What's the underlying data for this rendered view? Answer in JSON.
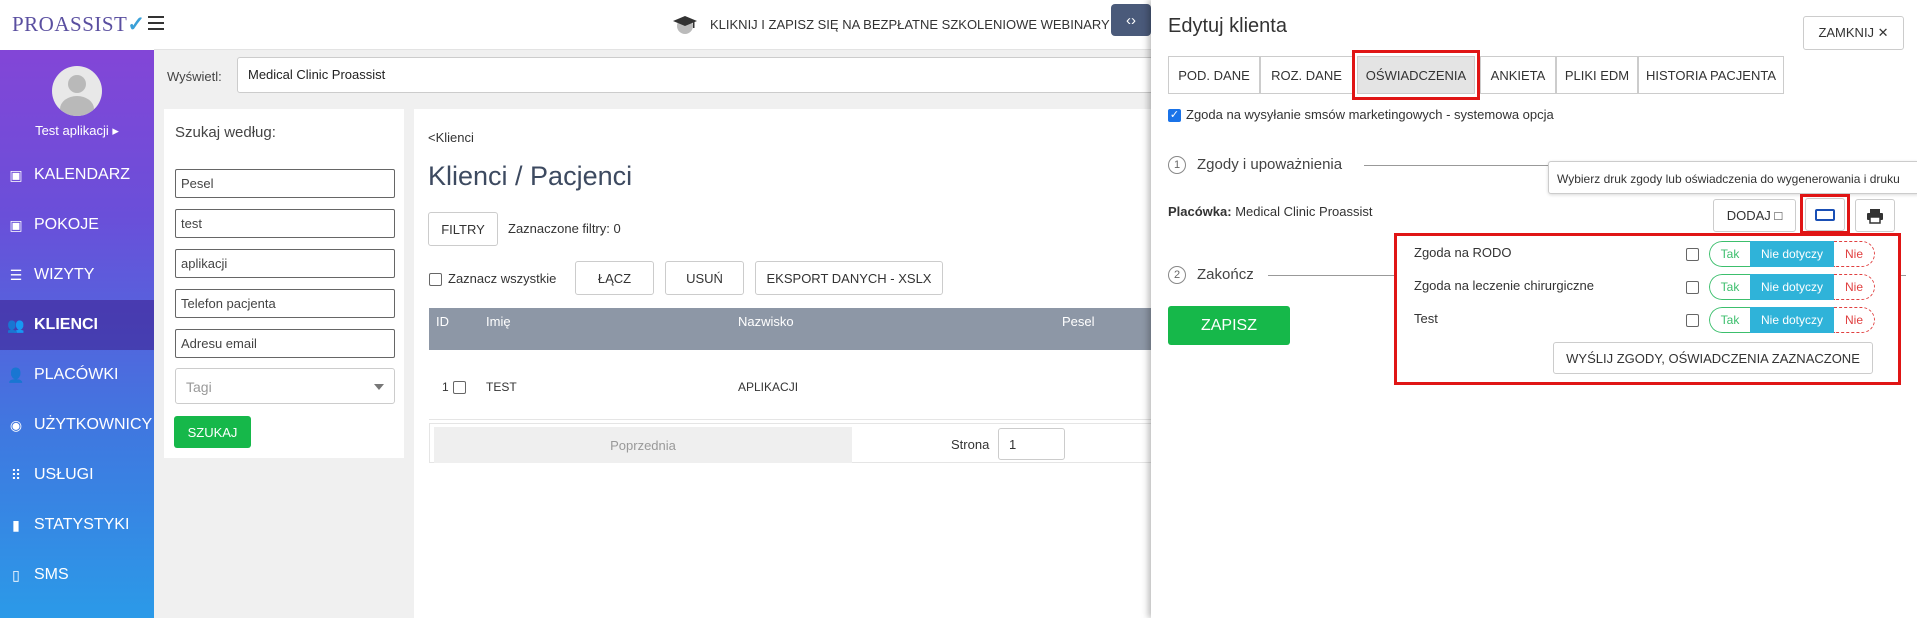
{
  "logo": {
    "text": "PROASSIST",
    "check": "✓"
  },
  "sidebar": {
    "user_name": "Test aplikacji ▸",
    "items": [
      {
        "label": "KALENDARZ",
        "icon": "calendar-icon"
      },
      {
        "label": "POKOJE",
        "icon": "rooms-icon"
      },
      {
        "label": "WIZYTY",
        "icon": "visits-icon"
      },
      {
        "label": "KLIENCI",
        "icon": "clients-icon",
        "active": true
      },
      {
        "label": "PLACÓWKI",
        "icon": "add-user-icon"
      },
      {
        "label": "UŻYTKOWNICY",
        "icon": "user-icon"
      },
      {
        "label": "USŁUGI",
        "icon": "grid-icon"
      },
      {
        "label": "STATYSTYKI",
        "icon": "bar-chart-icon"
      },
      {
        "label": "SMS",
        "icon": "phone-icon"
      }
    ]
  },
  "topbar": {
    "webinar_text": "KLIKNIJ I ZAPISZ SIĘ NA BEZPŁATNE SZKOLENIOWE WEBINARY",
    "toggle": "‹›"
  },
  "display": {
    "label": "Wyświetl:",
    "value": "Medical Clinic Proassist"
  },
  "search": {
    "title": "Szukaj według:",
    "fields": [
      "Pesel",
      "test",
      "aplikacji",
      "Telefon pacjenta",
      "Adresu email"
    ],
    "tags_placeholder": "Tagi",
    "button": "SZUKAJ"
  },
  "clients": {
    "breadcrumb": "<Klienci",
    "title": "Klienci / Pacjenci",
    "filters_button": "FILTRY",
    "filters_info": "Zaznaczone filtry: 0",
    "select_all": "Zaznacz wszystkie",
    "merge_button": "ŁĄCZ",
    "delete_button": "USUŃ",
    "export_button": "EKSPORT DANYCH - XSLX",
    "columns": [
      "ID",
      "Imię",
      "Nazwisko",
      "Pesel"
    ],
    "rows": [
      {
        "id": "1",
        "first": "TEST",
        "last": "APLIKACJI"
      }
    ],
    "prev": "Poprzednia",
    "page_label": "Strona",
    "page": "1"
  },
  "edit": {
    "title": "Edytuj klienta",
    "close": "ZAMKNIJ ✕",
    "tabs": [
      "POD. DANE",
      "ROZ. DANE",
      "OŚWIADCZENIA",
      "ANKIETA",
      "PLIKI EDM",
      "HISTORIA PACJENTA"
    ],
    "consent_label": "Zgoda na wysyłanie smsów marketingowych - systemowa opcja",
    "step1": {
      "num": "1",
      "label": "Zgody i upoważnienia"
    },
    "step2": {
      "num": "2",
      "label": "Zakończ"
    },
    "tooltip": "Wybierz druk zgody lub oświadczenia do wygenerowania i druku",
    "placowka_label": "Placówka:",
    "placowka_value": "Medical Clinic Proassist",
    "add_button": "DODAJ",
    "consents": [
      {
        "name": "Zgoda na RODO"
      },
      {
        "name": "Zgoda na leczenie chirurgiczne"
      },
      {
        "name": "Test"
      }
    ],
    "seg": {
      "tak": "Tak",
      "nd": "Nie dotyczy",
      "nie": "Nie"
    },
    "send_button": "WYŚLIJ ZGODY, OŚWIADCZENIA ZAZNACZONE",
    "save_button": "ZAPISZ"
  },
  "colors": {
    "green": "#16b84a",
    "red_highlight": "#e01515",
    "nd_blue": "#2fb3d9"
  }
}
